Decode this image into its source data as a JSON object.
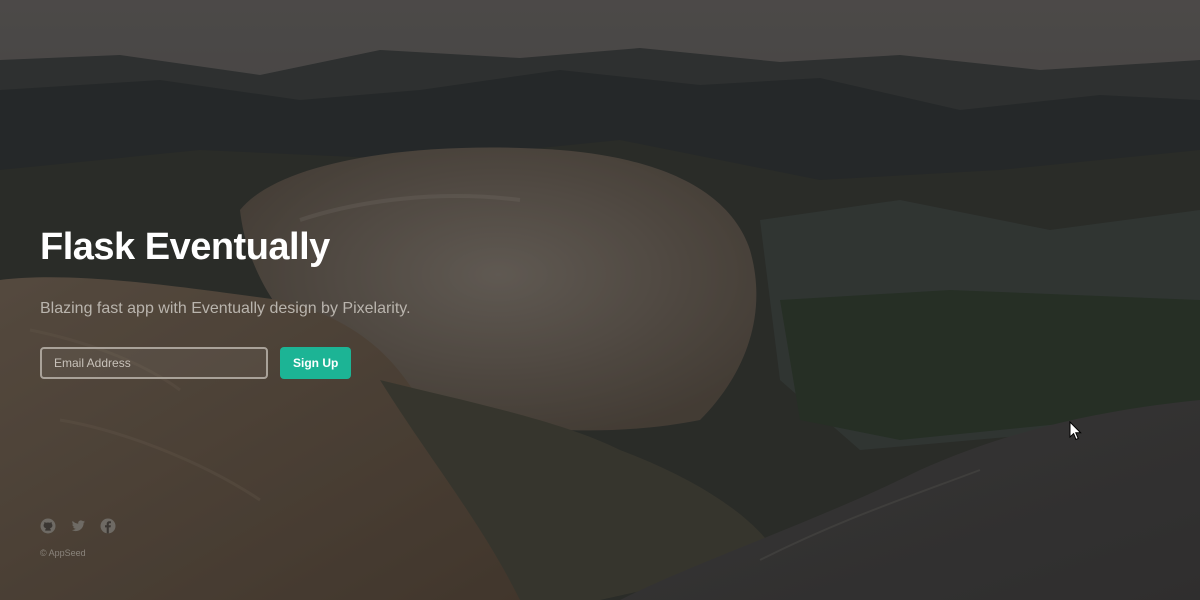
{
  "hero": {
    "title": "Flask Eventually",
    "tagline": "Blazing fast app with Eventually design by Pixelarity."
  },
  "signup": {
    "email_placeholder": "Email Address",
    "email_value": "",
    "button_label": "Sign Up"
  },
  "social": {
    "items": [
      {
        "icon": "github-icon"
      },
      {
        "icon": "twitter-icon"
      },
      {
        "icon": "facebook-icon"
      }
    ]
  },
  "footer": {
    "copyright": "© AppSeed"
  },
  "colors": {
    "accent": "#1cb495",
    "title": "#ffffff",
    "tagline": "#b9b4ad"
  }
}
